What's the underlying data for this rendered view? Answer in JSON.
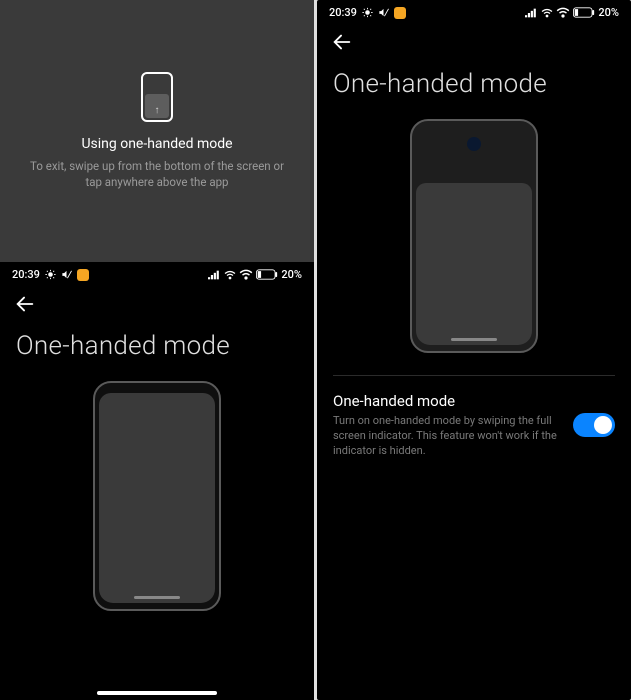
{
  "status": {
    "time": "20:39",
    "battery_pct": "20%",
    "icons": [
      "android-debug",
      "mute",
      "app-badge",
      "signal",
      "wifi-aux",
      "wifi",
      "battery"
    ]
  },
  "overlay": {
    "title": "Using one-handed mode",
    "description": "To exit, swipe up from the bottom of the screen or tap anywhere above the app"
  },
  "page": {
    "title": "One-handed mode"
  },
  "setting": {
    "title": "One-handed mode",
    "description": "Turn on one-handed mode by swiping the full screen indicator. This feature won't work if the indicator is hidden.",
    "enabled": true
  },
  "colors": {
    "accent": "#0a84ff",
    "bg": "#000000",
    "overlay_bg": "#3a3a3a"
  }
}
